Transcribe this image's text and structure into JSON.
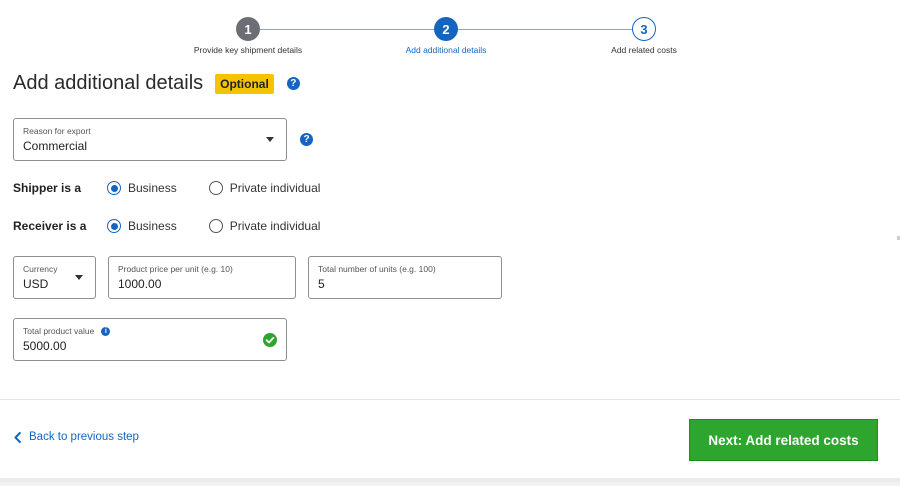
{
  "stepper": {
    "steps": [
      {
        "number": "1",
        "label": "Provide key shipment details",
        "state": "done"
      },
      {
        "number": "2",
        "label": "Add additional details",
        "state": "active"
      },
      {
        "number": "3",
        "label": "Add related costs",
        "state": "todo"
      }
    ]
  },
  "header": {
    "title": "Add additional details",
    "badge": "Optional",
    "help_glyph": "?"
  },
  "reason_for_export": {
    "label": "Reason for export",
    "value": "Commercial",
    "help_glyph": "?"
  },
  "shipper": {
    "label": "Shipper is a",
    "options": [
      "Business",
      "Private individual"
    ],
    "selected": "Business"
  },
  "receiver": {
    "label": "Receiver is a",
    "options": [
      "Business",
      "Private individual"
    ],
    "selected": "Business"
  },
  "currency": {
    "label": "Currency",
    "value": "USD"
  },
  "unit_price": {
    "label": "Product price per unit (e.g. 10)",
    "value": "1000.00"
  },
  "units": {
    "label": "Total number of units (e.g. 100)",
    "value": "5"
  },
  "total_value": {
    "label": "Total product value",
    "info_glyph": "i",
    "value": "5000.00"
  },
  "footer": {
    "back_label": "Back to previous step",
    "next_label": "Next: Add related costs"
  },
  "colors": {
    "accent": "#1565c0",
    "badge": "#f5c400",
    "next_button": "#2ea52e",
    "valid_check": "#2ea52e"
  }
}
